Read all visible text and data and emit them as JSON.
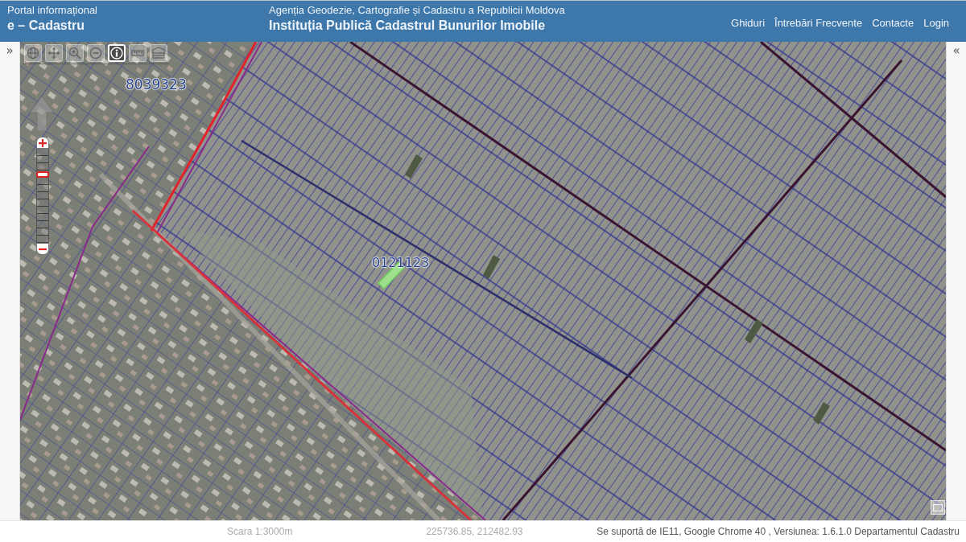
{
  "header": {
    "portal_label": "Portal informațional",
    "portal_name": "e – Cadastru",
    "agency": "Agenția Geodezie, Cartografie și Cadastru a Republicii Moldova",
    "institution": "Instituția Publică Cadastrul Bunurilor Imobile",
    "nav_links": [
      "Ghiduri",
      "Întrebări Frecvente",
      "Contacte",
      "Login"
    ]
  },
  "left_panel": {
    "toggle": "»"
  },
  "map": {
    "toolbar": [
      {
        "kind": "full-extent",
        "selected": false
      },
      {
        "kind": "pan",
        "selected": false
      },
      {
        "kind": "zoom-in",
        "selected": false
      },
      {
        "kind": "zoom-out",
        "selected": false
      },
      {
        "kind": "info",
        "selected": true
      },
      {
        "kind": "measure-line",
        "selected": false
      },
      {
        "kind": "measure-area",
        "selected": false
      }
    ],
    "zoom_slider": {
      "level": 0.73
    },
    "parcel_labels": [
      "8039323",
      "0121123"
    ]
  },
  "right_panel": {
    "toggle": "«"
  },
  "footer": {
    "scale": "Scara 1:3000m",
    "coordinates": "225736.85, 212482.93",
    "version_info": "Se suportă de IE11, Google Chrome 40 , Versiunea: 1.6.1.0 Departamentul Cadastru"
  }
}
